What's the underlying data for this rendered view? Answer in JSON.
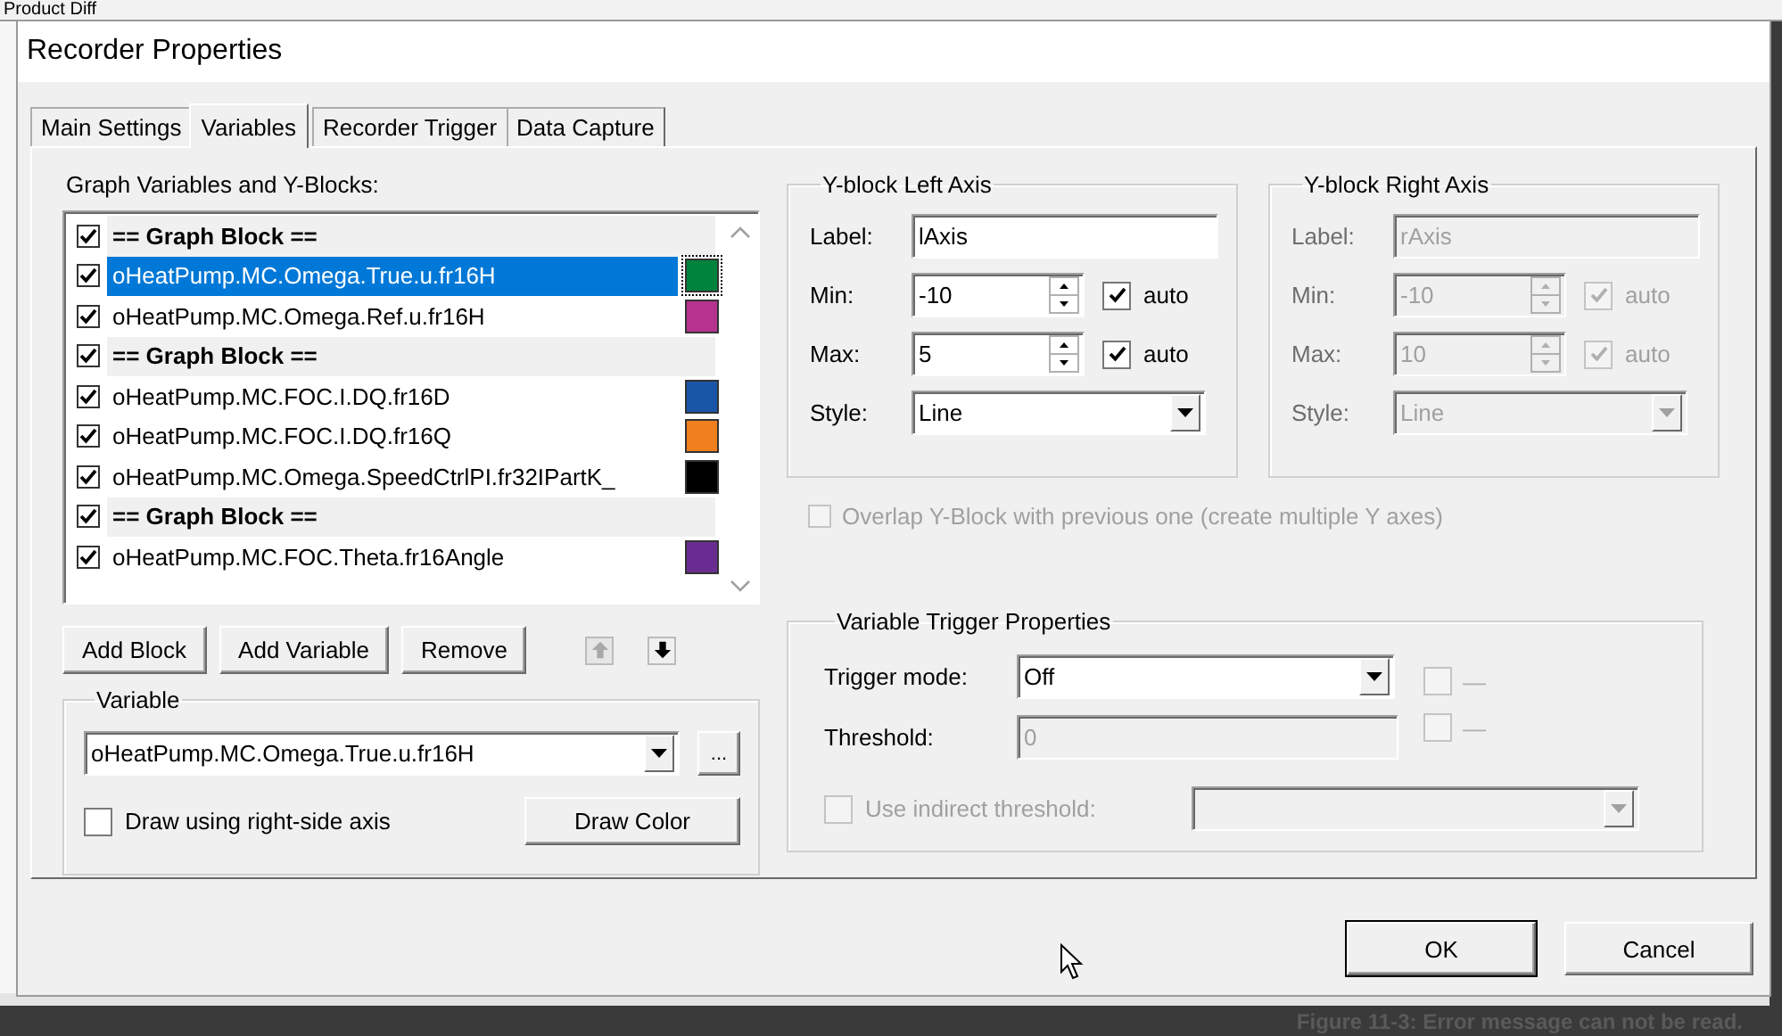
{
  "background": {
    "top_text": "Product Diff",
    "caption": "Figure 11-3: Error message can not be read."
  },
  "window": {
    "title": "Recorder Properties"
  },
  "tabs": [
    {
      "label": "Main Settings",
      "selected": false
    },
    {
      "label": "Variables",
      "selected": true
    },
    {
      "label": "Recorder Trigger",
      "selected": false
    },
    {
      "label": "Data Capture",
      "selected": false
    }
  ],
  "variables": {
    "label": "Graph Variables and Y-Blocks:",
    "items": [
      {
        "kind": "block",
        "name": "== Graph Block ==",
        "checked": true,
        "selected": false
      },
      {
        "kind": "variable",
        "name": "oHeatPump.MC.Omega.True.u.fr16H",
        "checked": true,
        "selected": true,
        "color": "#00843d"
      },
      {
        "kind": "variable",
        "name": "oHeatPump.MC.Omega.Ref.u.fr16H",
        "checked": true,
        "selected": false,
        "color": "#b5338f"
      },
      {
        "kind": "block",
        "name": "== Graph Block ==",
        "checked": true,
        "selected": false
      },
      {
        "kind": "variable",
        "name": "oHeatPump.MC.FOC.I.DQ.fr16D",
        "checked": true,
        "selected": false,
        "color": "#1a56a8"
      },
      {
        "kind": "variable",
        "name": "oHeatPump.MC.FOC.I.DQ.fr16Q",
        "checked": true,
        "selected": false,
        "color": "#f07f1d"
      },
      {
        "kind": "variable",
        "name": "oHeatPump.MC.Omega.SpeedCtrlPI.fr32IPartK_",
        "checked": true,
        "selected": false,
        "color": "#000000"
      },
      {
        "kind": "block",
        "name": "== Graph Block ==",
        "checked": true,
        "selected": false
      },
      {
        "kind": "variable",
        "name": "oHeatPump.MC.FOC.Theta.fr16Angle",
        "checked": true,
        "selected": false,
        "color": "#6a2d91"
      }
    ]
  },
  "list_buttons": [
    "Add Block",
    "Add Variable",
    "Remove"
  ],
  "move_buttons": [
    {
      "kind": "up",
      "disabled": true
    },
    {
      "kind": "down",
      "disabled": false
    }
  ],
  "variable_group": {
    "title": "Variable",
    "value": "oHeatPump.MC.Omega.True.u.fr16H",
    "browse": "...",
    "right_axis": {
      "label": "Draw using right-side axis",
      "checked": false
    },
    "color_button": "Draw Color"
  },
  "left_axis": {
    "title": "Y-block Left Axis",
    "disabled": false,
    "label": {
      "label": "Label:",
      "value": "lAxis"
    },
    "min": {
      "label": "Min:",
      "value": "-10",
      "auto": "auto",
      "checked": true
    },
    "max": {
      "label": "Max:",
      "value": "5",
      "auto": "auto",
      "checked": true
    },
    "style": {
      "label": "Style:",
      "value": "Line"
    }
  },
  "right_axis": {
    "title": "Y-block Right Axis",
    "disabled": true,
    "label": {
      "label": "Label:",
      "value": "rAxis"
    },
    "min": {
      "label": "Min:",
      "value": "-10",
      "auto": "auto",
      "checked": true
    },
    "max": {
      "label": "Max:",
      "value": "10",
      "auto": "auto",
      "checked": true
    },
    "style": {
      "label": "Style:",
      "value": "Line"
    }
  },
  "overlap": {
    "label": "Overlap Y-Block with previous one (create multiple Y axes)",
    "checked": false,
    "disabled": true
  },
  "trigger": {
    "title": "Variable Trigger Properties",
    "mode": {
      "label": "Trigger mode:",
      "value": "Off"
    },
    "side_checks": [
      {
        "label": "—",
        "checked": false
      },
      {
        "label": "—",
        "checked": false
      }
    ],
    "threshold": {
      "label": "Threshold:",
      "value": "0",
      "disabled": true
    },
    "indirect": {
      "label": "Use indirect threshold:",
      "checked": false,
      "disabled": true
    }
  },
  "buttons": [
    {
      "label": "OK",
      "default": true
    },
    {
      "label": "Cancel",
      "default": false
    }
  ]
}
